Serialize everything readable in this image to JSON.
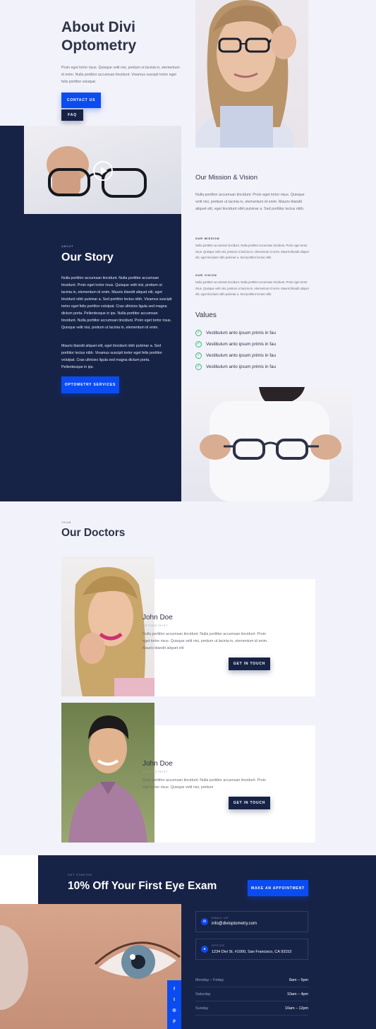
{
  "hero": {
    "title_line1": "About Divi",
    "title_line2": "Optometry",
    "text": "Proin eget tortor risus. Quisque velit nisi, pretium ut lacinia in, elementum id enim. Nulla porttitor accumsan tincidunt. Vivamus suscipit tortor eget felis porttitor volutpat.",
    "contact_button": "CONTACT US",
    "faq_button": "FAQ"
  },
  "mission": {
    "title": "Our Mission & Vision",
    "text": "Nulla porttitor accumsan tincidunt. Proin eget tortor risus. Quisque velit nisi, pretium ut lacinia in, elementum id enim. Mauris blandit aliquet elit, eget tincidunt nibh pulvinar a. Sed porttitor lectus nibh.",
    "mission_label": "OUR MISSION",
    "mission_text": "Nulla porttitor accumsan tincidunt. Nulla porttitor accumsan tincidunt. Proin eget tortor risus. Quisque velit nisi, pretium ut lacinia in, elementum id enim. Mauris blandit aliquet elit, eget tincidunt nibh pulvinar a. Sed porttitor lectus nibh.",
    "vision_label": "OUR VISION",
    "vision_text": "Nulla porttitor accumsan tincidunt. Nulla porttitor accumsan tincidunt. Proin eget tortor risus. Quisque velit nisi, pretium ut lacinia in, elementum id enim. Mauris blandit aliquet elit, eget tincidunt nibh pulvinar a. Sed porttitor lectus nibh."
  },
  "values": {
    "title": "Values",
    "items": [
      "Vestibulum anto ipsum primis in fau",
      "Vestibulum anto ipsum primis in fau",
      "Vestibulum anto ipsum primis in fau",
      "Vestibulum anto ipsum primis in fau"
    ]
  },
  "story": {
    "label": "ABOUT",
    "title": "Our Story",
    "p1": "Nulla porttitor accumsan tincidunt. Nulla porttitor accumsan tincidunt. Proin eget tortor risus. Quisque velit nisi, pretium ut lacinia in, elementum id enim. Mauris blandit aliquet elit, eget tincidunt nibh pulvinar a. Sed porttitor lectus nibh. Vivamus suscipit tortor eget felis porttitor volutpat. Cras ultricies ligula sed magna dictum porta. Pellentesque in ips. Nulla porttitor accumsan tincidunt. Nulla porttitor accumsan tincidunt. Proin eget tortor risus. Quisque velit nisi, pretium ut lacinia in, elementum id enim.",
    "p2": "Mauris blandit aliquet elit, eget tincidunt nibh pulvinar a. Sed porttitor lectus nibh. Vivamus suscipit tortor eget felis porttitor volutpat. Cras ultricies ligula sed magna dictum porta. Pellentesque in ips.",
    "button": "OPTOMETRY SERVICES"
  },
  "doctors": {
    "label": "TEAM",
    "title": "Our Doctors",
    "list": [
      {
        "name": "John Doe",
        "role": "OPTOMETRIST",
        "text": "Nulla porttitor accumsan tincidunt. Nulla porttitor accumsan tincidunt. Proin eget tortor risus. Quisque velit nisi, pretium ut lacinia in, elementum id enim. Mauris blandit aliquet elit",
        "button": "GET IN TOUCH"
      },
      {
        "name": "John Doe",
        "role": "OPTOMETRIST",
        "text": "Nulla porttitor accumsan tincidunt. Nulla porttitor accumsan tincidunt. Proin eget tortor risus. Quisque velit nisi, pretium",
        "button": "GET IN TOUCH"
      }
    ]
  },
  "cta": {
    "label": "GET STARTED",
    "title": "10% Off Your First Eye Exam",
    "button": "MAKE AN APPOINTMENT"
  },
  "contact": {
    "email_label": "EMAIL US",
    "email": "info@diviop­tometry.com",
    "office_label": "OFFICE",
    "address": "1234 Divi St. #1000, San Francisco, CA 93152",
    "hours": [
      {
        "day": "Monday – Friday",
        "time": "8am – 5pm"
      },
      {
        "day": "Saturday",
        "time": "10am – 4pm"
      },
      {
        "day": "Sunday",
        "time": "10am – 12pm"
      }
    ]
  },
  "social": [
    "f",
    "t",
    "ig",
    "p"
  ],
  "colors": {
    "navy": "#172346",
    "blue": "#0a4cf2",
    "bg": "#f2f2fa",
    "green": "#3cb878"
  }
}
